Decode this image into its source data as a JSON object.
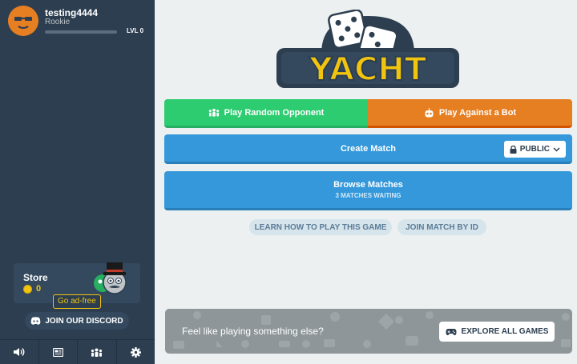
{
  "profile": {
    "username": "testing4444",
    "rank": "Rookie",
    "level_label": "LVL 0",
    "xp_progress": 0
  },
  "store": {
    "title": "Store",
    "coins": "0",
    "ad_free_label": "Go ad-free"
  },
  "discord": {
    "label": "JOIN OUR DISCORD"
  },
  "bottom_bar": [
    "speaker-icon",
    "news-icon",
    "group-icon",
    "gear-icon"
  ],
  "logo": {
    "text": "YACHT"
  },
  "main": {
    "random_opponent_label": "Play Random Opponent",
    "bot_label": "Play Against a Bot",
    "create_match_label": "Create Match",
    "visibility_label": "PUBLIC",
    "browse_label": "Browse Matches",
    "browse_sub": "3 MATCHES WAITING",
    "learn_label": "LEARN HOW TO PLAY THIS GAME",
    "join_by_id_label": "JOIN MATCH BY ID"
  },
  "explore": {
    "prompt": "Feel like playing something else?",
    "button_label": "EXPLORE ALL GAMES"
  },
  "colors": {
    "sidebar": "#2c3e50",
    "green": "#2ecc71",
    "orange": "#e67e22",
    "blue": "#3498db",
    "gold": "#f1c40f"
  }
}
